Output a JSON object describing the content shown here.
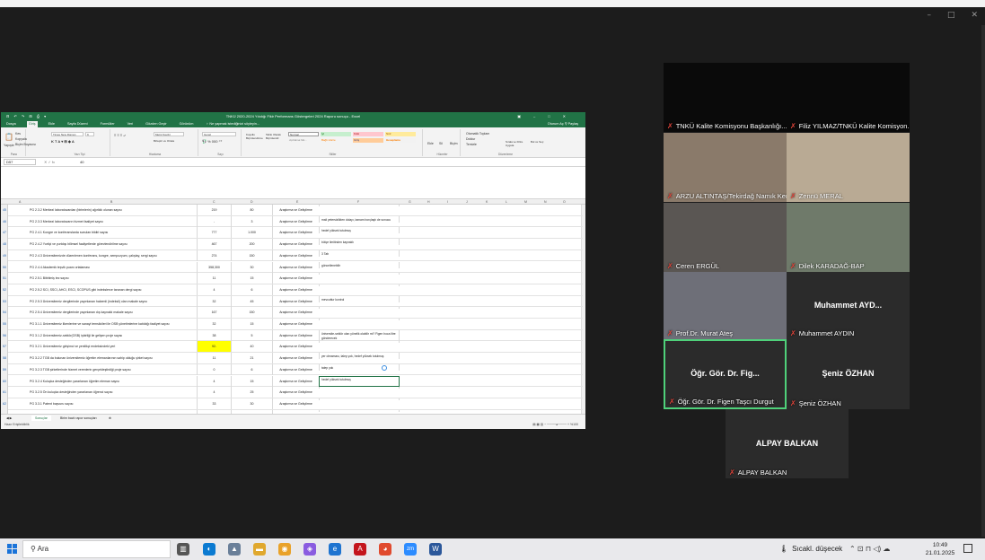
{
  "window_controls": {
    "minimize": "–",
    "maximize": "□",
    "close": "✕"
  },
  "excel": {
    "title": "TNKÜ 2020-2024 Yılıdığı Fikir Performans Göstergeleri 2024 Raporu sonuçu - Excel",
    "quick_access": "⊟ ↶ ↷ ⊞ ⎙ ▾",
    "tabs": [
      "Dosya",
      "Giriş",
      "Ekle",
      "Sayfa Düzeni",
      "Formüller",
      "Veri",
      "Gözden Geçir",
      "Görünüm",
      "♀ Ne yapmak istediğinizi söyleyin..."
    ],
    "tabs_right": "Oturum Aç   ⚲ Paylaş",
    "ribbon": {
      "paste": "Yapıştır",
      "cut": "Kes",
      "copy": "Kopyala",
      "painter": "Biçim Boyacısı",
      "clipboard": "Pano",
      "font_name": "Times New Roman",
      "font_size": "9",
      "font": "Yazı Tipi",
      "wrap": "Metni Kaydır",
      "merge": "Birleştir ve Ortala",
      "alignment": "Hizalama",
      "number_fmt": "Genel",
      "number": "Sayı",
      "cond_fmt": "Koşullu Biçimlendirme",
      "table_fmt": "Tablo Olarak Biçimlendir",
      "styles_label": "Stiller",
      "style_normal": "Normal",
      "style_iyi": "İyi",
      "style_kotu": "Kötü",
      "style_notr": "Nötr",
      "style_aciklama": "Açıklama Me...",
      "style_bagli": "Bağlı Hücre",
      "style_giris": "Giriş",
      "style_hesaplama": "Hesaplama",
      "insert": "Ekle",
      "delete": "Sil",
      "format": "Biçim",
      "cells": "Hücreler",
      "autosum": "Otomatik Toplam",
      "fill": "Doldur",
      "clear": "Temizle",
      "sort": "Sırala ve Filtre Uygula",
      "find": "Bul ve Seç",
      "editing": "Düzenleme"
    },
    "name_box": "D57",
    "fx": "✕  ✓  fx",
    "formula_value": "40",
    "columns": [
      "A",
      "B",
      "C",
      "D",
      "E",
      "F",
      "G",
      "H",
      "I",
      "J",
      "K",
      "L",
      "M",
      "N",
      "O"
    ],
    "rows": [
      {
        "num": "45",
        "b": "PG 2.3.2 Merkezi laboratuvardan (birimlerin) ağırlıklı olunan sayısı",
        "c": "219",
        "d": "80",
        "e": "Araştırma ve Geliştirme",
        "f": ""
      },
      {
        "num": "46",
        "b": "PG 2.3.3 Merkezi laboratuvarın hizmet faaliyet sayısı",
        "c": "-",
        "d": "3",
        "e": "Araştırma ve Geliştirme",
        "f": "mali yetersizlikten dolayı, tamam borçlaştı de sonucu"
      },
      {
        "num": "47",
        "b": "PG 2.4.1 Kongre ve konferanslarda sunulan bildiri sayısı",
        "c": "777",
        "d": "1.000",
        "e": "Araştırma ve Geliştirme",
        "f": "hedef yüksek tutulmuş"
      },
      {
        "num": "48",
        "b": "PG 2.4.2 Yurtiçi ve yurtdışı bilimsel faaliyetlerde görevlendirilme sayısı",
        "c": "467",
        "d": "200",
        "e": "Araştırma ve Geliştirme",
        "f": "bütçe limitinden kaynaklı"
      },
      {
        "num": "49",
        "b": "PG 2.4.3 Üniversitemizde düzenlenen konferans, kongre, sempozyum, çalıştay, sergi sayısı",
        "c": "274",
        "d": "150",
        "e": "Araştırma ve Geliştirme",
        "f": "3 Tab"
      },
      {
        "num": "50",
        "b": "PG 2.4.4 Akademik teşvik puanı ortalaması",
        "c": "358,300",
        "d": "30",
        "e": "Araştırma ve Geliştirme",
        "f": "güncellenebilir"
      },
      {
        "num": "51",
        "b": "PG 2.5.1 Bitirilmiş tez sayısı",
        "c": "11",
        "d": "15",
        "e": "Araştırma ve Geliştirme",
        "f": ""
      },
      {
        "num": "52",
        "b": "PG 2.5.2 SCI, SSCI, AHCI, ESCI, SCOPUS gibi indekslerce taranan dergi sayısı",
        "c": "4",
        "d": "6",
        "e": "Araştırma ve Geliştirme",
        "f": ""
      },
      {
        "num": "53",
        "b": "PG 2.5.3 Üniversitemiz dergilerinde yayınlanan hakemli (indeksli) olan makale sayısı",
        "c": "32",
        "d": "45",
        "e": "Araştırma ve Geliştirme",
        "f": "mevcuttur kontrol"
      },
      {
        "num": "54",
        "b": "PG 2.5.4 Üniversitemiz dergilerinde yayınlanan dış kaynaklı makale sayısı",
        "c": "167",
        "d": "150",
        "e": "Araştırma ve Geliştirme",
        "f": ""
      },
      {
        "num": "55",
        "b": "PG 3.1.1 Üniversitemiz ilkenlerine ve sanayi temsilcileri ile OSB yönetimlerine katıldığı faaliyet sayısı",
        "c": "32",
        "d": "15",
        "e": "Araştırma ve Geliştirme",
        "f": ""
      },
      {
        "num": "56",
        "b": "PG 3.1.2 Üniversitemiz-sektör(OSB) işbirliği ile gelişen proje sayısı",
        "c": "38",
        "d": "5",
        "e": "Araştırma ve Geliştirme",
        "f": "üniversite-sektör olan yönelik olabilir mi? Figen hoca litre gönderecek"
      },
      {
        "num": "57",
        "b": "PG 3.2.1 Üniversitemiz girişimci ve yenilikçi endeksindeki yeri",
        "c": "92-",
        "d": "40",
        "e": "Araştırma ve Geliştirme",
        "f": "",
        "hl": true
      },
      {
        "num": "58",
        "b": "PG 3.2.2 TGB da bulunan üniversitemiz öğretim elemanlarının sahip olduğu şirket sayısı",
        "c": "11",
        "d": "21",
        "e": "Araştırma ve Geliştirme",
        "f": "yer olmaması, talep yok, hedef yüksek tutulmuş"
      },
      {
        "num": "59",
        "b": "PG 3.2.3 TGB şirketlerinde hizmet verenlerin gerçekleştirdiği proje sayısı",
        "c": "0",
        "d": "6",
        "e": "Araştırma ve Geliştirme",
        "f": "talep yok"
      },
      {
        "num": "60",
        "b": "PG 3.2.4 Kuluçka desteğinden yararlanan öğretim eleman sayısı",
        "c": "4",
        "d": "15",
        "e": "Araştırma ve Geliştirme",
        "f": "hedef yüksek tutulmuş"
      },
      {
        "num": "61",
        "b": "PG 3.2.5 Ön kuluçka desteğinden yararlanan öğrenci sayısı",
        "c": "4",
        "d": "25",
        "e": "Araştırma ve Geliştirme",
        "f": ""
      },
      {
        "num": "62",
        "b": "PG 3.3.1 Patent başvuru sayısı",
        "c": "33",
        "d": "30",
        "e": "Araştırma ve Geliştirme",
        "f": ""
      },
      {
        "num": "63",
        "b": "PG 3.3.2 Patent lisanslama sayısı",
        "c": "0",
        "d": "30",
        "e": "Araştırma ve Geliştirme",
        "f": ""
      }
    ],
    "sheet_tabs": [
      "Sonuçlar",
      "Birim bazlı rapor sonuçları",
      "⊕"
    ],
    "status_left": "Hazır   Erişilebilirlik",
    "status_right": "▤  ▦  ▥   −  ────●────  +  %100"
  },
  "participants": [
    {
      "name": "TNKÜ Kalite Komisyonu Başkanlığı...",
      "big": ""
    },
    {
      "name": "Filiz YILMAZ/TNKÜ Kalite Komisyon...",
      "big": ""
    },
    {
      "name": "ARZU ALTINTAŞ/Tekirdağ Namık Kema...",
      "big": ""
    },
    {
      "name": "Zennü MERAL",
      "big": ""
    },
    {
      "name": "Ceren ERGÜL",
      "big": ""
    },
    {
      "name": "Dilek KARADAĞ-BAP",
      "big": ""
    },
    {
      "name": "Prof.Dr. Murat Ateş",
      "big": ""
    },
    {
      "name": "Muhammet AYDIN",
      "big": "Muhammet  AYD..."
    },
    {
      "name": "Öğr. Gör. Dr. Figen Taşcı Durgut",
      "big": "Öğr. Gör. Dr. Fig..."
    },
    {
      "name": "Şeniz ÖZHAN",
      "big": "Şeniz ÖZHAN"
    },
    {
      "name": "ALPAY BALKAN",
      "big": "ALPAY BALKAN"
    }
  ],
  "mic_icon": "✗",
  "taskbar": {
    "search": "Ara",
    "weather_icon": "🌡",
    "weather": "Sıcakl. düşecek",
    "tray": "⌃  ⊡  ⊓  ◁)  ☁",
    "time": "10:49",
    "date": "21.01.2025",
    "apps": [
      "▥",
      "◐",
      "▲",
      "▬",
      "◉",
      "◈",
      "e",
      "A",
      "◕",
      "zm",
      "W"
    ]
  },
  "colors": {
    "excel_green": "#217346",
    "speaking": "#4fd17a",
    "muted": "#e0443a",
    "highlight": "#ffff00"
  }
}
